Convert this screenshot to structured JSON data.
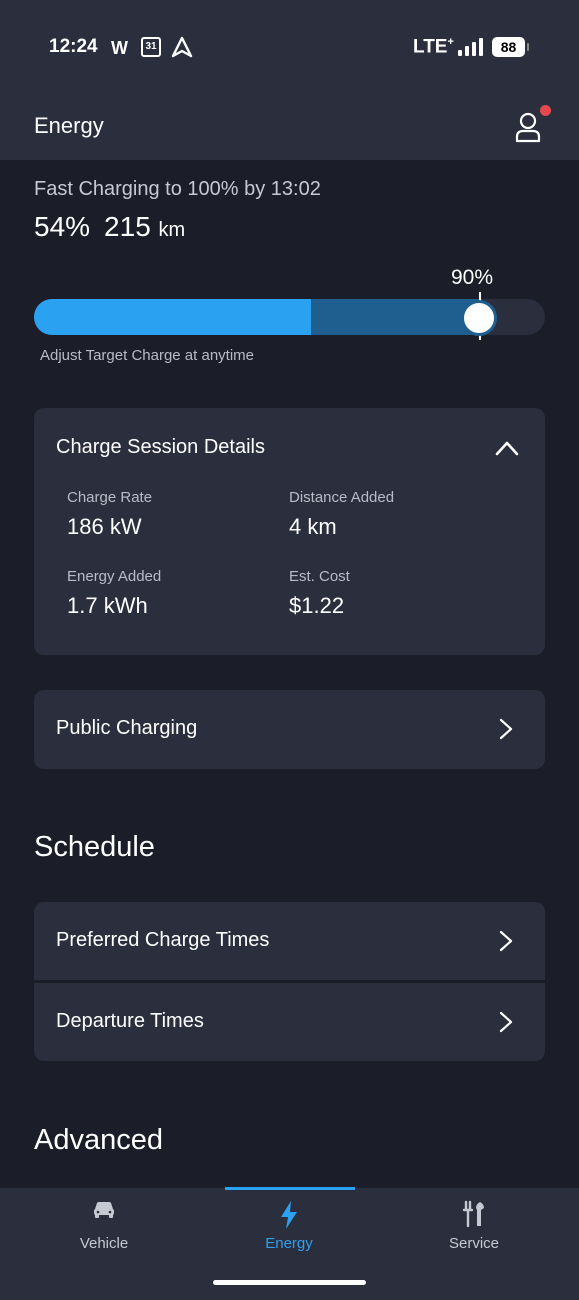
{
  "status_bar": {
    "time": "12:24",
    "notification_w": "W",
    "calendar_day": "31",
    "network": "LTE",
    "network_plus": "+",
    "battery": "88"
  },
  "header": {
    "title": "Energy"
  },
  "charge": {
    "status_text": "Fast Charging to 100% by 13:02",
    "battery_percent": "54%",
    "range_value": "215",
    "range_unit": "km",
    "target_label": "90%",
    "current_level": 0.54,
    "target_level": 0.9,
    "hint": "Adjust Target Charge at anytime"
  },
  "session": {
    "title": "Charge Session Details",
    "charge_rate_label": "Charge Rate",
    "charge_rate_value": "186 kW",
    "distance_added_label": "Distance Added",
    "distance_added_value": "4 km",
    "energy_added_label": "Energy Added",
    "energy_added_value": "1.7 kWh",
    "est_cost_label": "Est. Cost",
    "est_cost_value": "$1.22"
  },
  "public_charging": {
    "label": "Public Charging"
  },
  "schedule": {
    "title": "Schedule",
    "preferred_label": "Preferred Charge Times",
    "departure_label": "Departure Times"
  },
  "advanced": {
    "title": "Advanced"
  },
  "bottom_nav": {
    "vehicle": "Vehicle",
    "energy": "Energy",
    "service": "Service",
    "accent_color": "#2aa1f1"
  }
}
